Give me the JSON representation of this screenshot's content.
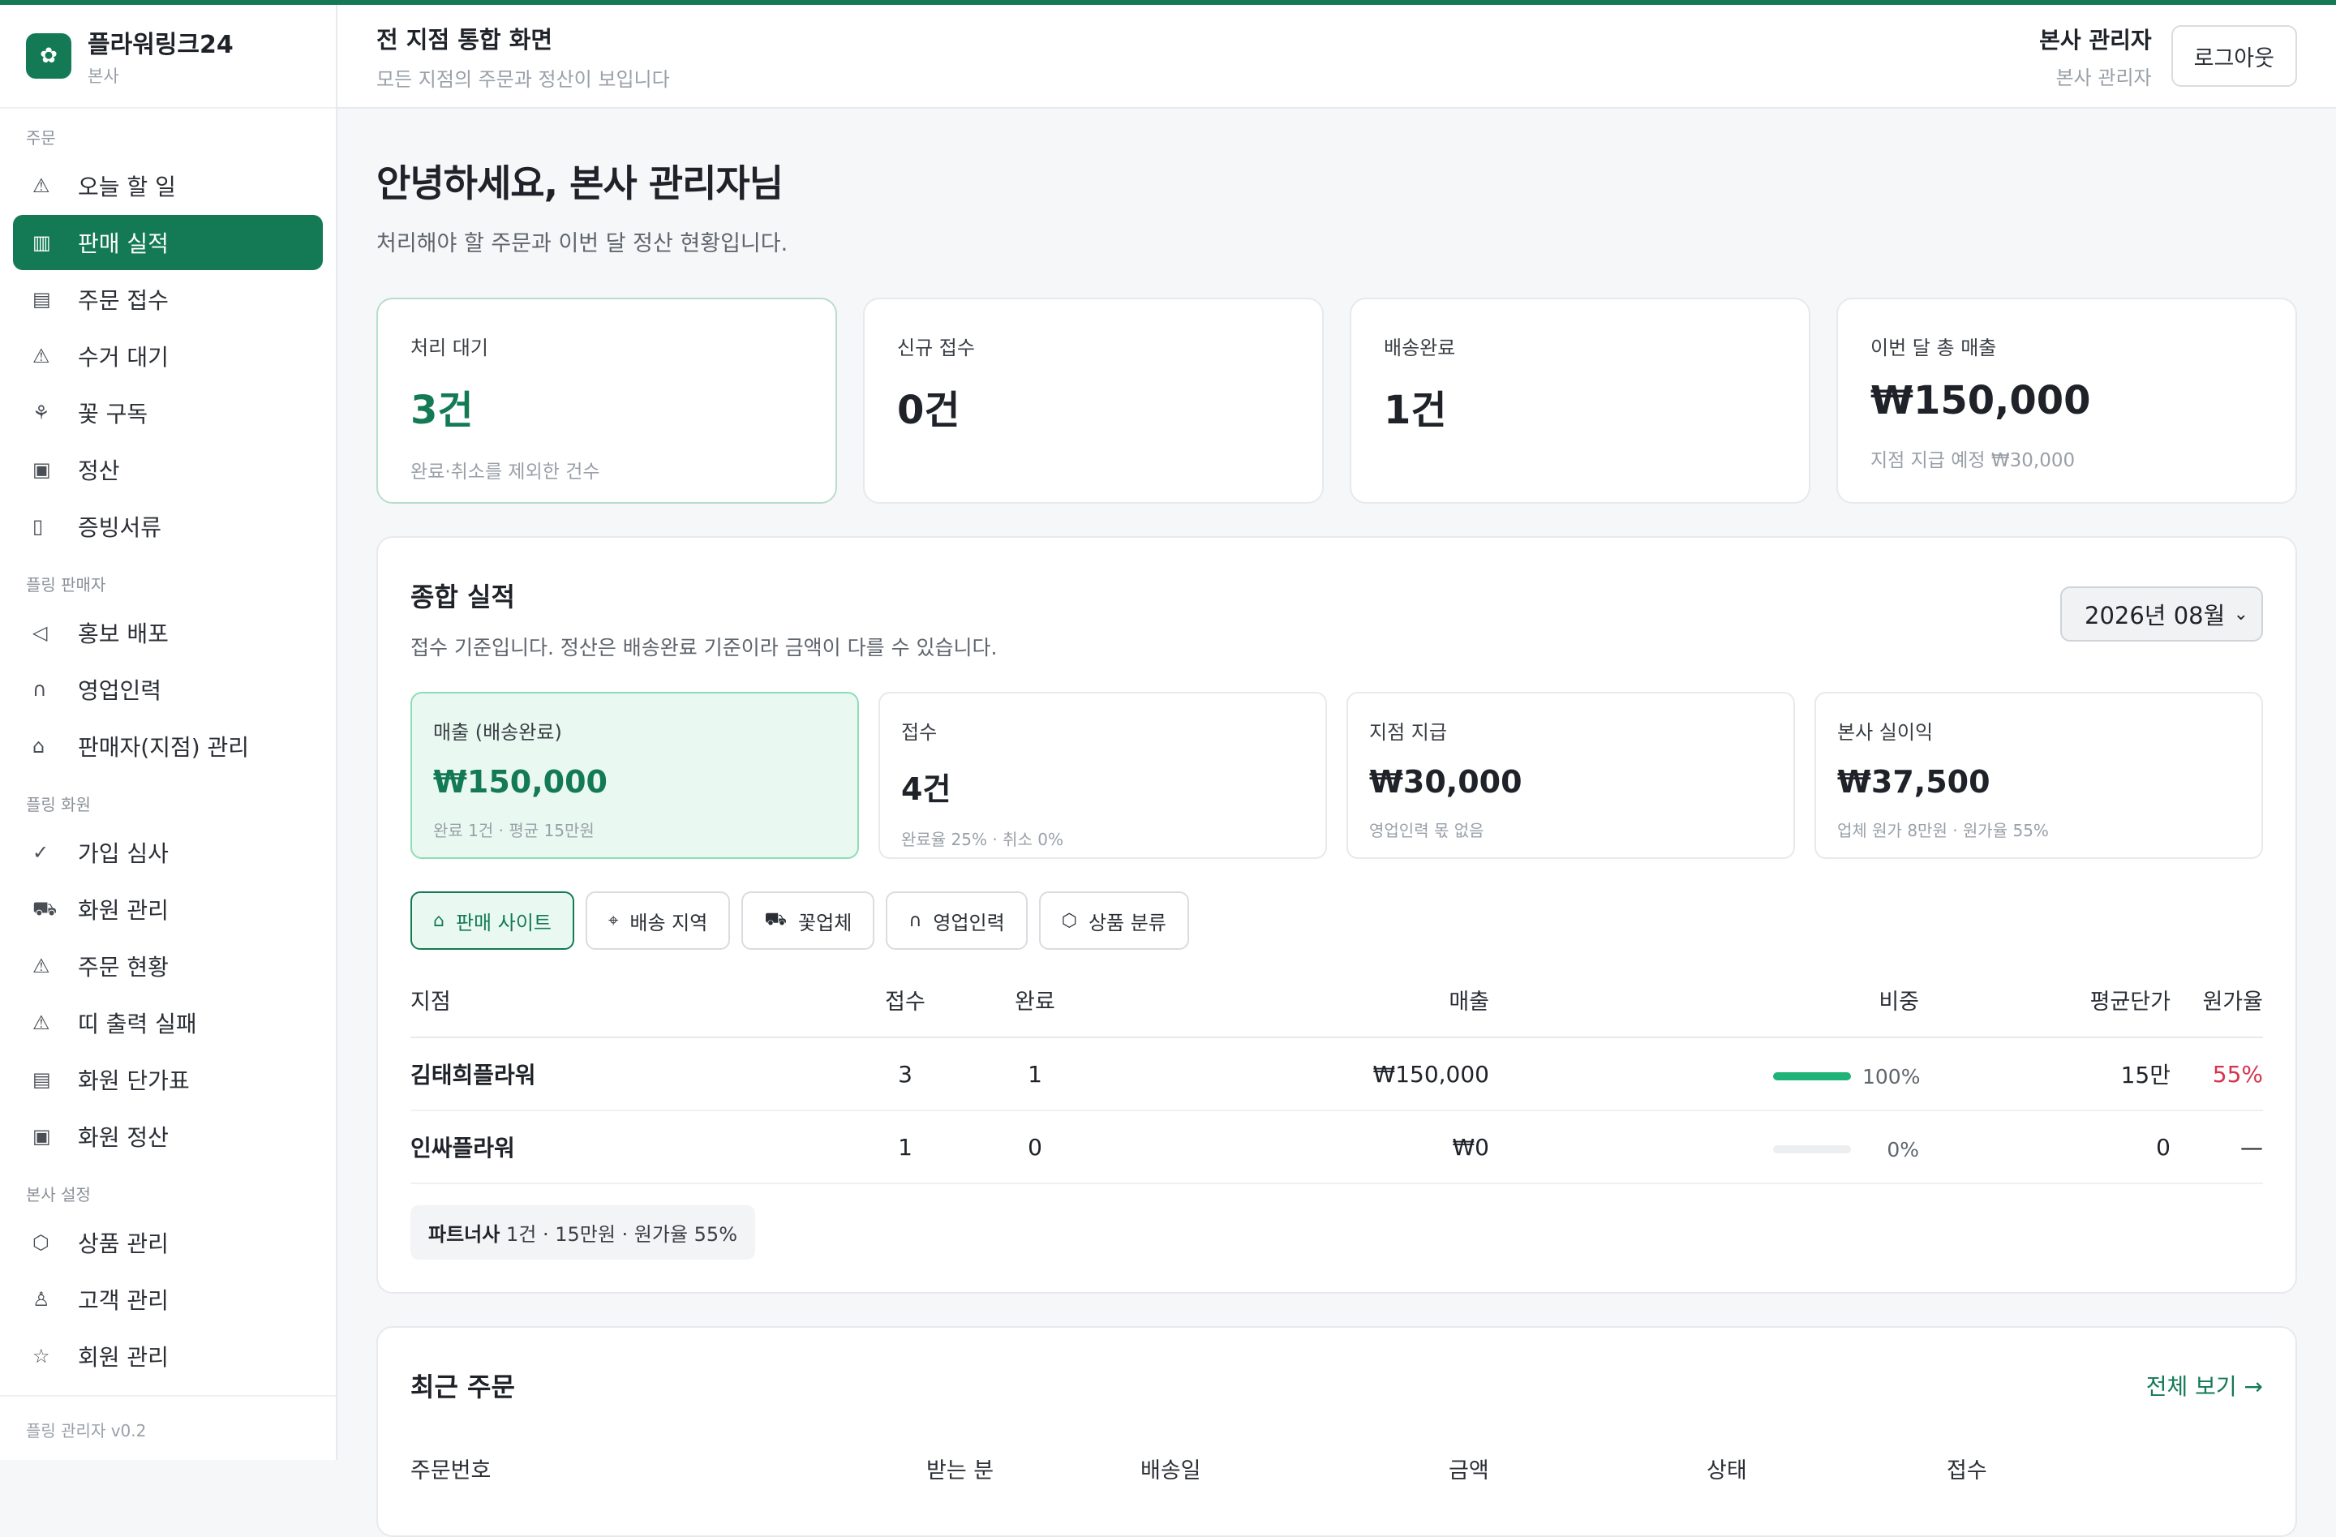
{
  "colors": {
    "brand": "#137a55",
    "accent_light": "#e9f9f1",
    "danger": "#d6334f"
  },
  "brand": {
    "name": "플라워링크24",
    "sub": "본사",
    "logo_icon": "flower-icon"
  },
  "sidebar": {
    "groups": [
      {
        "label": "주문",
        "items": [
          {
            "label": "오늘 할 일",
            "icon": "warning-icon"
          },
          {
            "label": "판매 실적",
            "icon": "bar-chart-icon",
            "active": true
          },
          {
            "label": "주문 접수",
            "icon": "clipboard-icon"
          },
          {
            "label": "수거 대기",
            "icon": "warning-icon"
          },
          {
            "label": "꽃 구독",
            "icon": "sprout-icon"
          },
          {
            "label": "정산",
            "icon": "wallet-icon"
          },
          {
            "label": "증빙서류",
            "icon": "document-icon"
          }
        ]
      },
      {
        "label": "플링 판매자",
        "items": [
          {
            "label": "홍보 배포",
            "icon": "megaphone-icon"
          },
          {
            "label": "영업인력",
            "icon": "headset-icon"
          },
          {
            "label": "판매자(지점) 관리",
            "icon": "store-icon"
          }
        ]
      },
      {
        "label": "플링 화원",
        "items": [
          {
            "label": "가입 심사",
            "icon": "check-icon"
          },
          {
            "label": "화원 관리",
            "icon": "truck-icon"
          },
          {
            "label": "주문 현황",
            "icon": "warning-icon"
          },
          {
            "label": "띠 출력 실패",
            "icon": "warning-icon"
          },
          {
            "label": "화원 단가표",
            "icon": "clipboard-icon"
          },
          {
            "label": "화원 정산",
            "icon": "wallet-icon"
          }
        ]
      },
      {
        "label": "본사 설정",
        "items": [
          {
            "label": "상품 관리",
            "icon": "box-icon"
          },
          {
            "label": "고객 관리",
            "icon": "user-icon"
          },
          {
            "label": "회원 관리",
            "icon": "star-icon"
          }
        ]
      }
    ],
    "footer": "플링 관리자 v0.2"
  },
  "header": {
    "title": "전 지점 통합 화면",
    "subtitle": "모든 지점의 주문과 정산이 보입니다",
    "user_name": "본사 관리자",
    "user_role": "본사 관리자",
    "logout_label": "로그아웃"
  },
  "main": {
    "greeting": "안녕하세요, 본사 관리자님",
    "greeting_sub": "처리해야 할 주문과 이번 달 정산 현황입니다.",
    "kpis": [
      {
        "label": "처리 대기",
        "value": "3건",
        "note": "완료·취소를 제외한 건수"
      },
      {
        "label": "신규 접수",
        "value": "0건",
        "note": ""
      },
      {
        "label": "배송완료",
        "value": "1건",
        "note": ""
      },
      {
        "label": "이번 달 총 매출",
        "value": "₩150,000",
        "note": "지점 지급 예정 ₩30,000"
      }
    ]
  },
  "summary": {
    "title": "종합 실적",
    "subtitle": "접수 기준입니다. 정산은 배송완료 기준이라 금액이 다를 수 있습니다.",
    "month": "2026년 08월",
    "subkpis": [
      {
        "label": "매출 (배송완료)",
        "value": "₩150,000",
        "note": "완료 1건 · 평균 15만원"
      },
      {
        "label": "접수",
        "value": "4건",
        "note": "완료율 25% · 취소 0%"
      },
      {
        "label": "지점 지급",
        "value": "₩30,000",
        "note": "영업인력 몫 없음"
      },
      {
        "label": "본사 실이익",
        "value": "₩37,500",
        "note": "업체 원가 8만원 · 원가율 55%"
      }
    ],
    "tabs": [
      {
        "label": "판매 사이트",
        "icon": "store-icon"
      },
      {
        "label": "배송 지역",
        "icon": "pin-icon"
      },
      {
        "label": "꽃업체",
        "icon": "truck-icon"
      },
      {
        "label": "영업인력",
        "icon": "headset-icon"
      },
      {
        "label": "상품 분류",
        "icon": "box-icon"
      }
    ],
    "table": {
      "headers": [
        "지점",
        "접수",
        "완료",
        "매출",
        "비중",
        "평균단가",
        "원가율"
      ],
      "rows": [
        {
          "shop": "김태희플라워",
          "received": "3",
          "done": "1",
          "sales": "₩150,000",
          "share": 1.0,
          "share_label": "100%",
          "avg": "15만",
          "cost": "55%"
        },
        {
          "shop": "인싸플라워",
          "received": "1",
          "done": "0",
          "sales": "₩0",
          "share": 0.0,
          "share_label": "0%",
          "avg": "0",
          "cost": "—"
        }
      ]
    },
    "partner": {
      "name": "파트너사",
      "detail": "1건 · 15만원 · 원가율 55%"
    }
  },
  "recent": {
    "title": "최근 주문",
    "view_all": "전체 보기 →",
    "columns": [
      "주문번호",
      "받는 분",
      "배송일",
      "금액",
      "상태",
      "접수"
    ]
  }
}
